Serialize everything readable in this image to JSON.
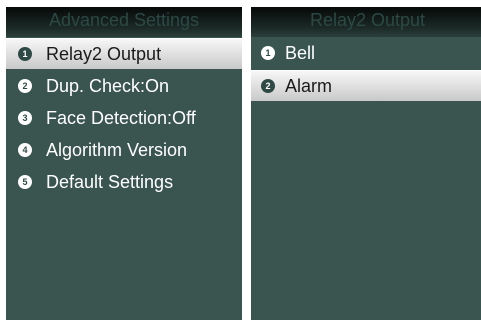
{
  "left_screen": {
    "title": "Advanced Settings",
    "items": [
      {
        "number": "1",
        "label": "Relay2 Output"
      },
      {
        "number": "2",
        "label": "Dup. Check:On"
      },
      {
        "number": "3",
        "label": "Face Detection:Off"
      },
      {
        "number": "4",
        "label": "Algorithm Version"
      },
      {
        "number": "5",
        "label": "Default Settings"
      }
    ],
    "selected_item": "Relay2 Output"
  },
  "right_screen": {
    "title": "Relay2 Output",
    "items": [
      {
        "number": "1",
        "label": "Bell"
      },
      {
        "number": "2",
        "label": "Alarm"
      }
    ],
    "selected_item": "Alarm"
  },
  "colors": {
    "screen_background": "#3a5550",
    "title_background": "#0f1715",
    "title_text": "#2c4943",
    "item_text": "#ffffff",
    "selection_highlight": "#e0e0e0"
  }
}
